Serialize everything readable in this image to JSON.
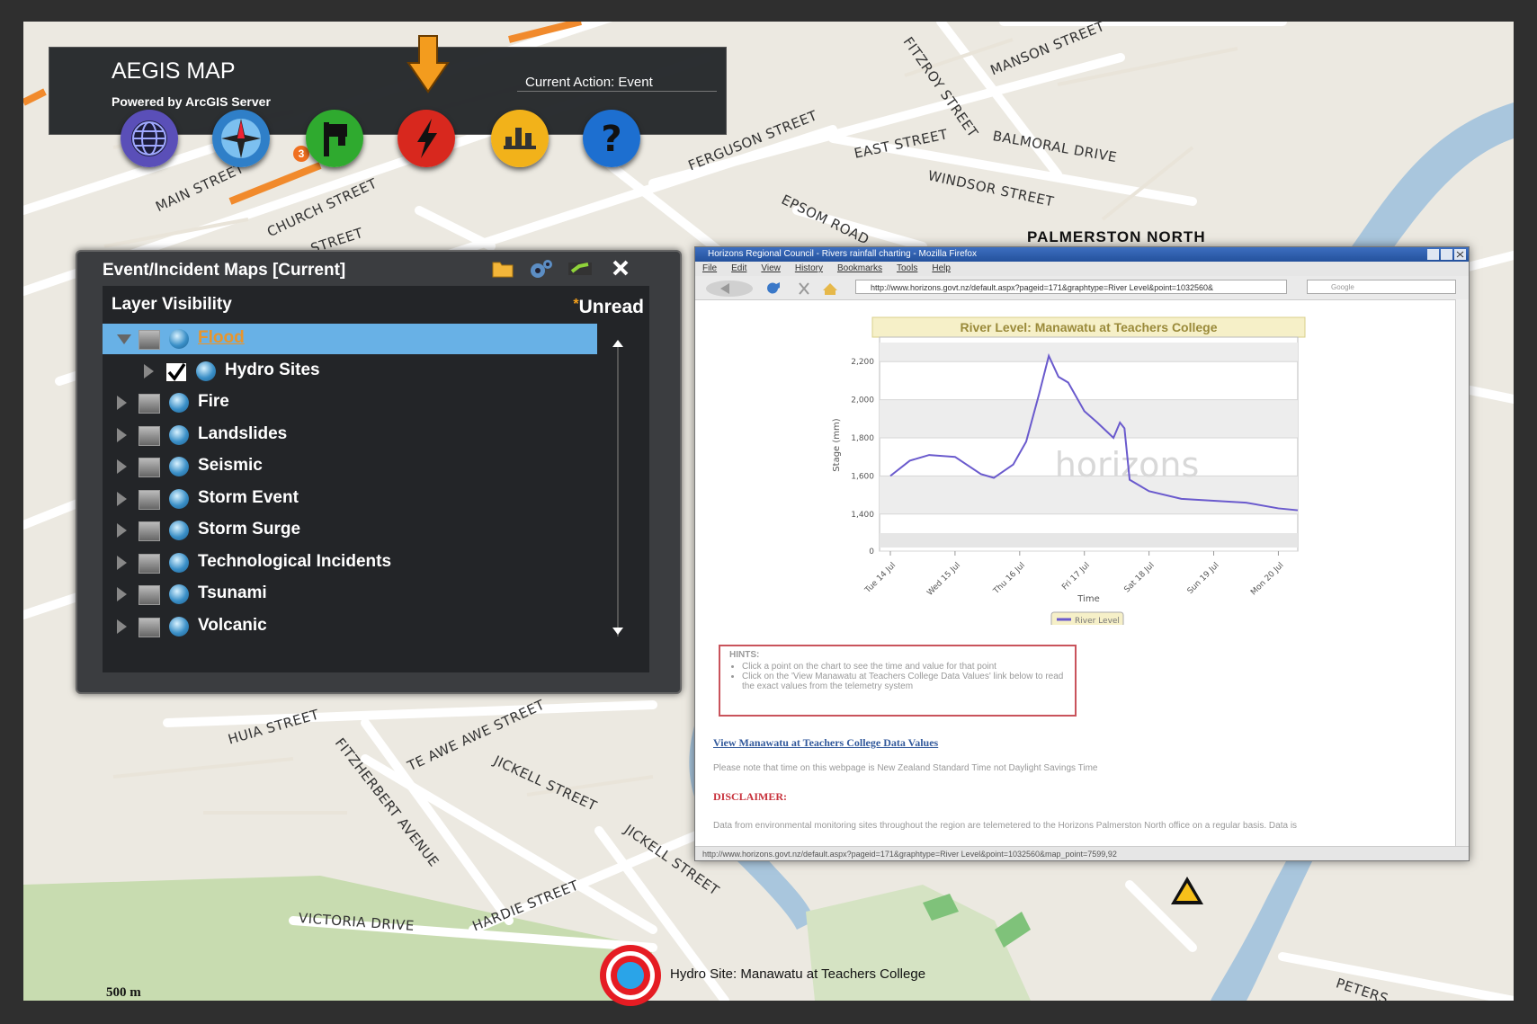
{
  "map": {
    "city_label": "PALMERSTON NORTH",
    "scale_label": "500 m",
    "streets": [
      {
        "text": "MAIN STREET",
        "x": 148,
        "y": 198,
        "rot": -25
      },
      {
        "text": "CHURCH STREET",
        "x": 272,
        "y": 226,
        "rot": -25
      },
      {
        "text": "STREET",
        "x": 320,
        "y": 244,
        "rot": -18
      },
      {
        "text": "FERGUSON STREET",
        "x": 740,
        "y": 152,
        "rot": -22
      },
      {
        "text": "EAST STREET",
        "x": 924,
        "y": 138,
        "rot": -12
      },
      {
        "text": "BALMORAL DRIVE",
        "x": 1078,
        "y": 118,
        "rot": 10
      },
      {
        "text": "MANSON STREET",
        "x": 1076,
        "y": 46,
        "rot": -22
      },
      {
        "text": "FITZROY STREET",
        "x": 982,
        "y": 10,
        "rot": 55
      },
      {
        "text": "WINDSOR STREET",
        "x": 1006,
        "y": 162,
        "rot": 12
      },
      {
        "text": "EPSOM ROAD",
        "x": 844,
        "y": 188,
        "rot": 26
      },
      {
        "text": "VICTORIA DRIVE",
        "x": 306,
        "y": 988,
        "rot": 4
      },
      {
        "text": "HARDIE STREET",
        "x": 500,
        "y": 998,
        "rot": -22
      },
      {
        "text": "HUIA STREET",
        "x": 228,
        "y": 790,
        "rot": -16
      },
      {
        "text": "TE AWE AWE STREET",
        "x": 428,
        "y": 820,
        "rot": -25
      },
      {
        "text": "JICKELL STREET",
        "x": 524,
        "y": 812,
        "rot": 25
      },
      {
        "text": "FITZHERBERT AVENUE",
        "x": 350,
        "y": 790,
        "rot": 52
      },
      {
        "text": "JICKELL STREET",
        "x": 670,
        "y": 888,
        "rot": 35
      },
      {
        "text": "PETERS",
        "x": 1460,
        "y": 1060,
        "rot": 18
      }
    ]
  },
  "header": {
    "title": "AEGIS MAP",
    "subtitle": "Powered by ArcGIS Server",
    "current_action": "Current Action: Event",
    "badge": "3",
    "tools": [
      {
        "name": "globe-tool",
        "color": "#5a4fb8"
      },
      {
        "name": "compass-tool",
        "color": "#2f7fc8"
      },
      {
        "name": "flag-tool",
        "color": "#2faa2f"
      },
      {
        "name": "event-tool",
        "color": "#d8281e"
      },
      {
        "name": "chart-tool",
        "color": "#f2b21a"
      },
      {
        "name": "help-tool",
        "color": "#1d6fd0"
      }
    ]
  },
  "panel": {
    "title": "Event/Incident Maps [Current]",
    "layer_visibility": "Layer Visibility",
    "unread_star": "*",
    "unread": "Unread",
    "layers": [
      {
        "label": "Flood",
        "expanded": true,
        "selected": true,
        "checked": false
      },
      {
        "label": "Hydro Sites",
        "child": true,
        "checked": true
      },
      {
        "label": "Fire"
      },
      {
        "label": "Landslides"
      },
      {
        "label": "Seismic"
      },
      {
        "label": "Storm Event"
      },
      {
        "label": "Storm Surge"
      },
      {
        "label": "Technological Incidents"
      },
      {
        "label": "Tsunami"
      },
      {
        "label": "Volcanic"
      }
    ]
  },
  "browser": {
    "title": "Horizons Regional Council - Rivers rainfall charting - Mozilla Firefox",
    "menu": [
      "File",
      "Edit",
      "View",
      "History",
      "Bookmarks",
      "Tools",
      "Help"
    ],
    "url": "http://www.horizons.govt.nz/default.aspx?pageid=171&graphtype=River Level&point=1032560&",
    "search_placeholder": "Google",
    "status": "http://www.horizons.govt.nz/default.aspx?pageid=171&graphtype=River Level&point=1032560&map_point=7599,92",
    "hints_title": "HINTS:",
    "hints": [
      "Click a point on the chart to see the time and value for that point",
      "Click on the 'View Manawatu at Teachers College Data Values' link below to read the exact values from the telemetry system"
    ],
    "link": "View Manawatu at Teachers College Data Values",
    "note": "Please note that time on this webpage is New Zealand Standard Time not Daylight Savings Time",
    "disclaimer": "DISCLAIMER:",
    "data_note": "Data from environmental monitoring sites throughout the region are telemetered to the Horizons Palmerston North office on a regular basis. Data is"
  },
  "chart_data": {
    "type": "line",
    "title": "River Level: Manawatu at Teachers College",
    "xlabel": "Time",
    "ylabel": "Stage (mm)",
    "ylim": [
      0,
      2300
    ],
    "yticks": [
      "0",
      "1,400",
      "1,600",
      "1,800",
      "2,000",
      "2,200"
    ],
    "categories": [
      "Tue 14 Jul",
      "Wed 15 Jul",
      "Thu 16 Jul",
      "Fri 17 Jul",
      "Sat 18 Jul",
      "Sun 19 Jul",
      "Mon 20 Jul"
    ],
    "series": [
      {
        "name": "River Level",
        "color": "#6a5acd",
        "x": [
          0,
          0.3,
          0.6,
          1.0,
          1.4,
          1.6,
          1.9,
          2.1,
          2.3,
          2.45,
          2.6,
          2.75,
          3.0,
          3.2,
          3.45,
          3.55,
          3.62,
          3.7,
          4.0,
          4.5,
          5.0,
          5.5,
          6.0,
          6.3
        ],
        "y": [
          1600,
          1680,
          1710,
          1700,
          1610,
          1590,
          1660,
          1780,
          2030,
          2230,
          2120,
          2090,
          1940,
          1880,
          1800,
          1880,
          1850,
          1580,
          1520,
          1480,
          1470,
          1460,
          1430,
          1420
        ]
      }
    ],
    "legend": "bottom",
    "watermark": "horizons"
  },
  "hydro_site": {
    "label": "Hydro Site: Manawatu at Teachers College"
  }
}
